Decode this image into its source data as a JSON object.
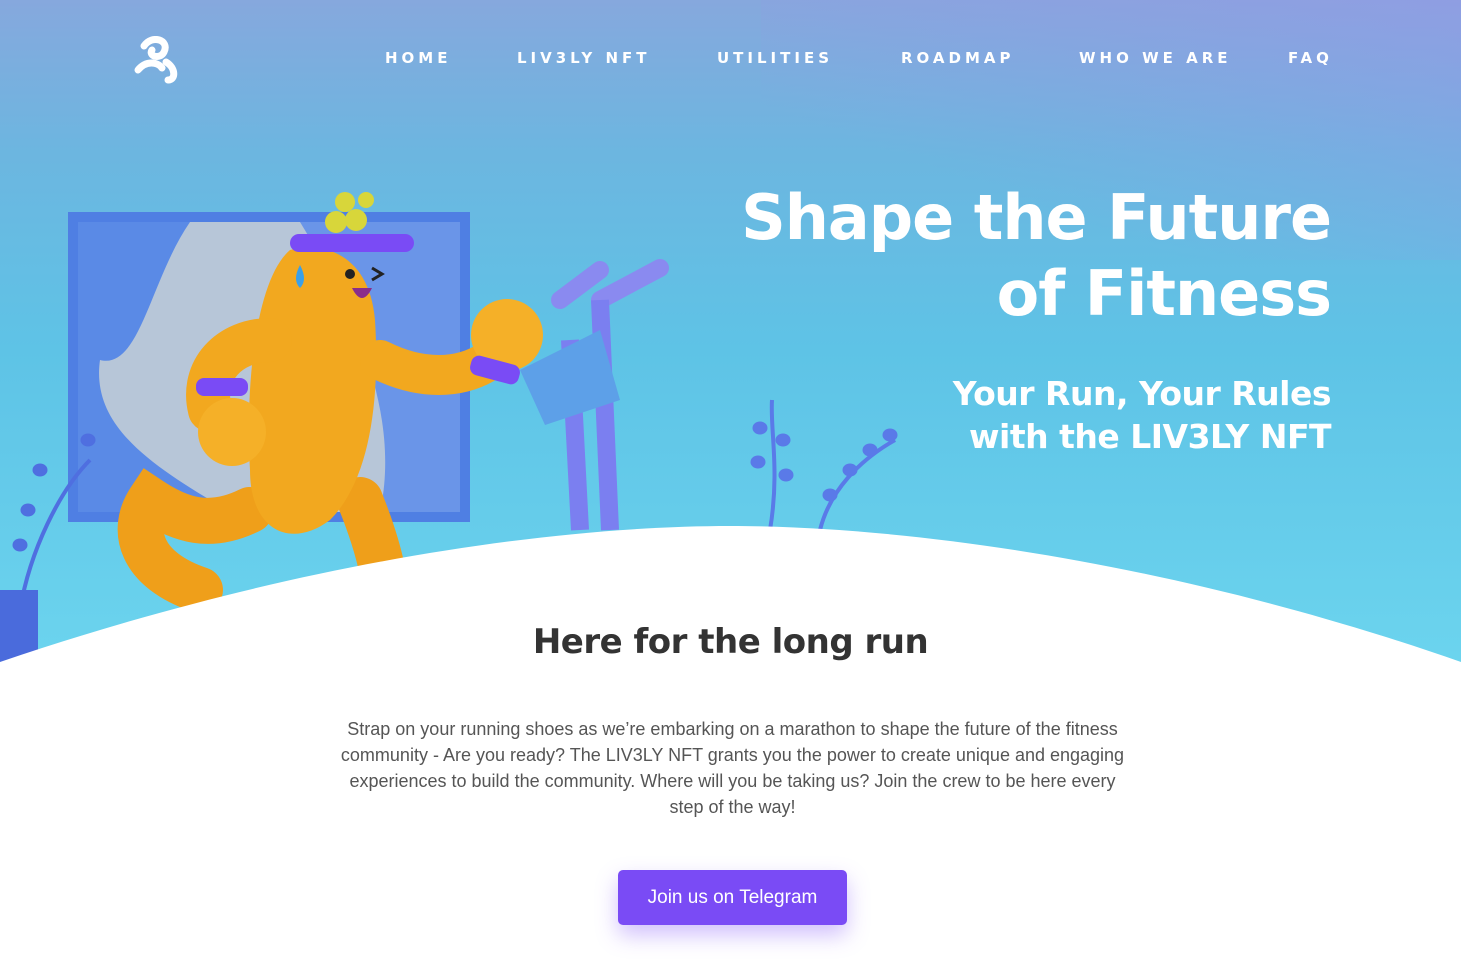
{
  "nav": {
    "items": [
      {
        "label": "HOME"
      },
      {
        "label": "LIV3LY NFT"
      },
      {
        "label": "UTILITIES"
      },
      {
        "label": "ROADMAP"
      },
      {
        "label": "WHO WE ARE"
      },
      {
        "label": "FAQ"
      }
    ]
  },
  "hero": {
    "headline_line1": "Shape the Future",
    "headline_line2": "of Fitness",
    "subheadline_line1": "Your Run, Your Rules",
    "subheadline_line2": "with the LIV3LY NFT"
  },
  "section": {
    "title": "Here for the long run",
    "body": "Strap on your running shoes as we’re embarking on a marathon to shape the future of the fitness community - Are you ready? The LIV3LY NFT grants you the power to create unique and engaging experiences to build the community. Where will you be taking us? Join the crew to be here every step of the way!"
  },
  "cta": {
    "label": "Join us on Telegram"
  },
  "icons": {
    "logo": "lively-logo-icon"
  },
  "colors": {
    "hero_top": "#86a8dd",
    "hero_bottom": "#6dd6ef",
    "accent": "#7a4bf5",
    "character": "#f2a81f",
    "headband": "#7a4bf5"
  }
}
